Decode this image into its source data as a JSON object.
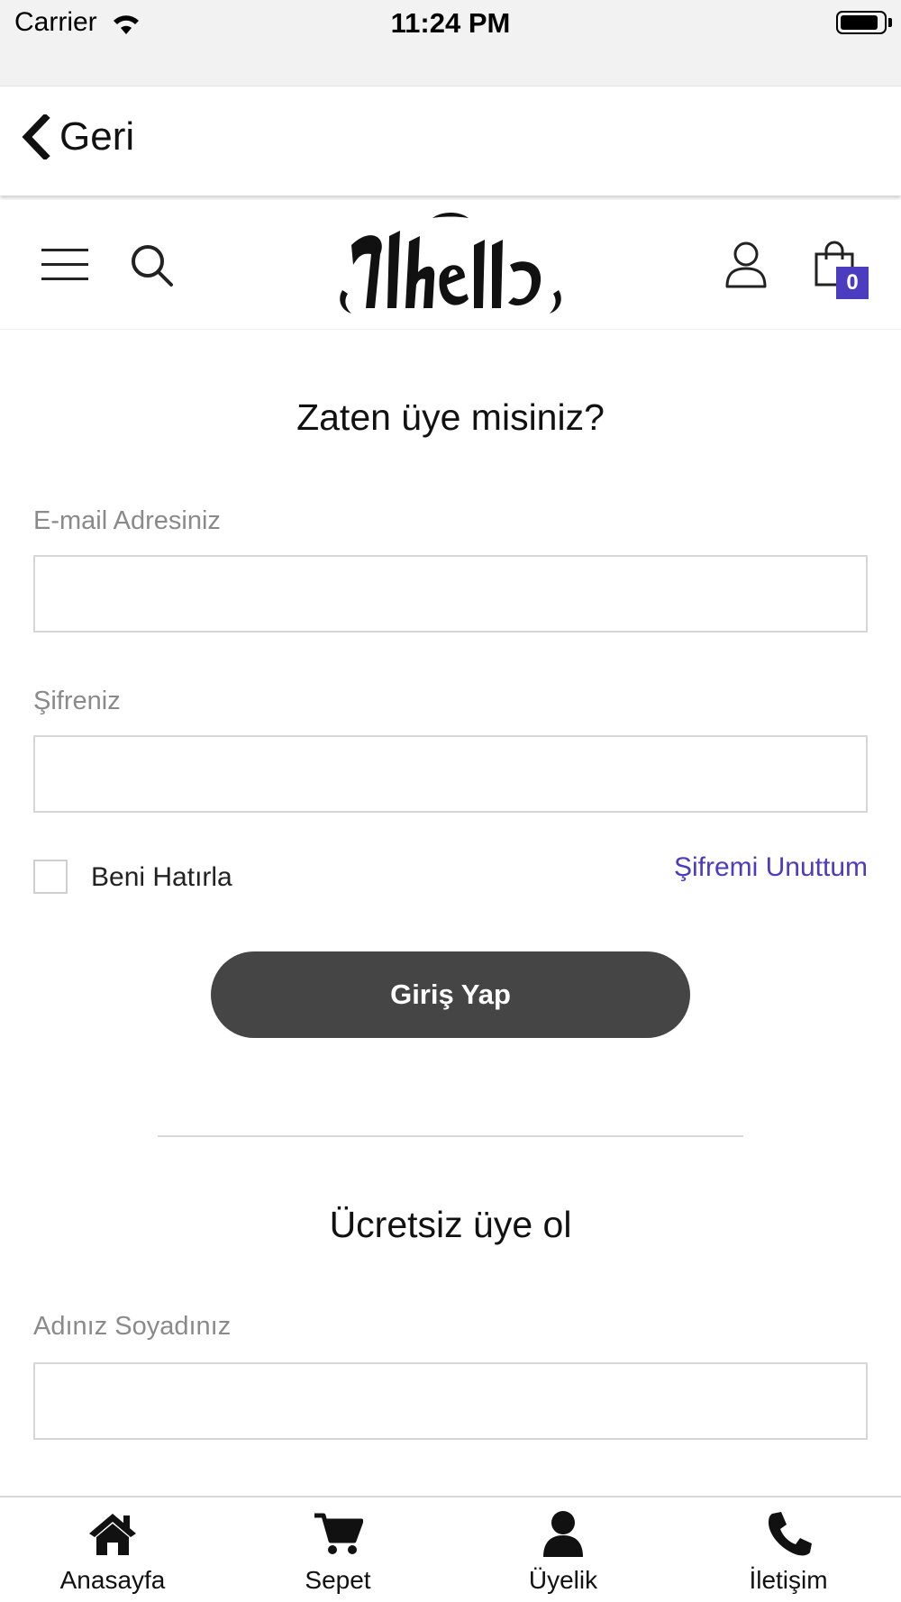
{
  "status_bar": {
    "carrier": "Carrier",
    "time": "11:24 PM",
    "battery_level": 0.9
  },
  "nav": {
    "back_label": "Geri"
  },
  "header": {
    "cart_count": "0",
    "icons": [
      "menu-icon",
      "search-icon",
      "user-icon",
      "shopping-bag-icon"
    ],
    "badge_color": "#4b3cc0"
  },
  "login": {
    "title": "Zaten üye misiniz?",
    "email_label": "E-mail Adresiniz",
    "email_value": "",
    "password_label": "Şifreniz",
    "password_value": "",
    "remember_label": "Beni Hatırla",
    "remember_checked": false,
    "forgot_label": "Şifremi Unuttum",
    "submit_label": "Giriş Yap"
  },
  "register": {
    "title": "Ücretsiz üye ol",
    "name_label": "Adınız Soyadınız",
    "name_value": ""
  },
  "tabs": [
    {
      "label": "Anasayfa",
      "icon": "home-icon"
    },
    {
      "label": "Sepet",
      "icon": "cart-icon"
    },
    {
      "label": "Üyelik",
      "icon": "user-icon"
    },
    {
      "label": "İletişim",
      "icon": "phone-icon"
    }
  ],
  "colors": {
    "accent": "#4b3cc0",
    "button": "#454545",
    "status_bar": "#f2f2f2"
  }
}
